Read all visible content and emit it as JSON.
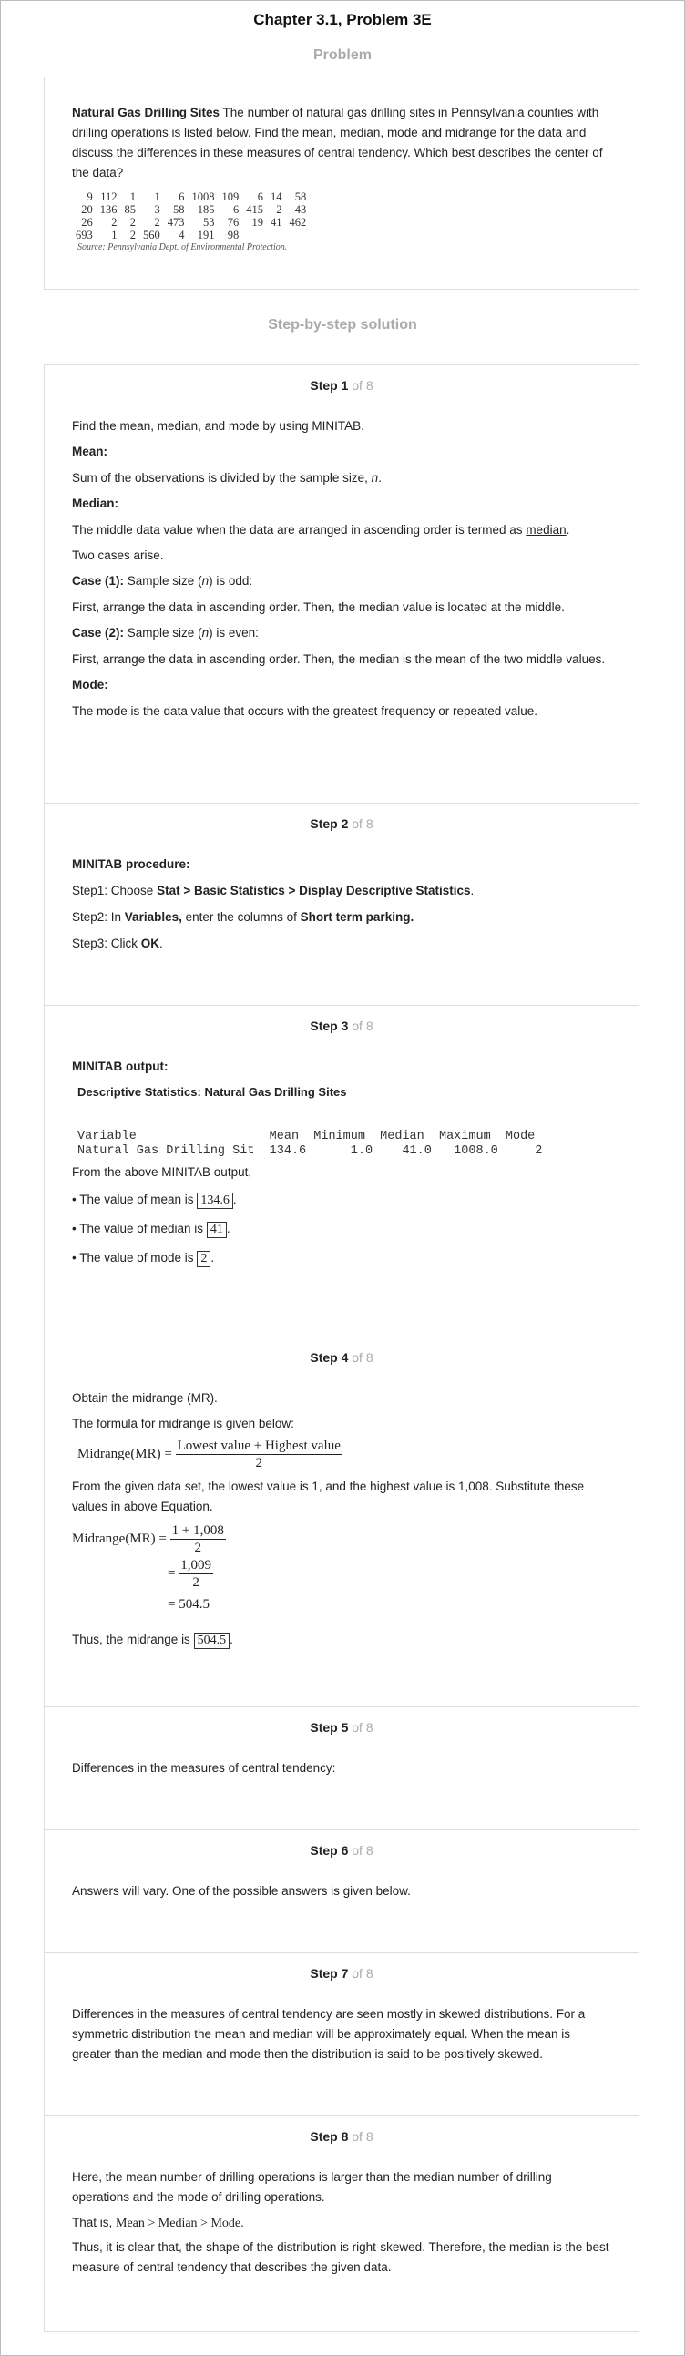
{
  "header": {
    "title": "Chapter 3.1, Problem 3E",
    "problem_heading": "Problem",
    "solution_heading": "Step-by-step solution"
  },
  "problem": {
    "bold": "Natural Gas Drilling Sites",
    "text": " The number of natural gas drilling sites in Pennsylvania counties with drilling operations is listed below. Find the mean, median, mode and midrange for the data and discuss the differences in these measures of central tendency. Which best describes the center of the data?",
    "table": [
      [
        "9",
        "112",
        "1",
        "1",
        "6",
        "1008",
        "109",
        "6",
        "14",
        "58"
      ],
      [
        "20",
        "136",
        "85",
        "3",
        "58",
        "185",
        "6",
        "415",
        "2",
        "43"
      ],
      [
        "26",
        "2",
        "2",
        "2",
        "473",
        "53",
        "76",
        "19",
        "41",
        "462"
      ],
      [
        "693",
        "1",
        "2",
        "560",
        "4",
        "191",
        "98",
        "",
        "",
        ""
      ]
    ],
    "source": "Source: Pennsylvania Dept. of Environmental Protection."
  },
  "step_of": " of 8",
  "steps": {
    "s1": {
      "label": "Step 1",
      "intro": "Find the mean, median, and mode by using MINITAB.",
      "mean_h": "Mean:",
      "mean_t1": "Sum of the observations is divided by the sample size, ",
      "mean_n": "n",
      "mean_t2": ".",
      "median_h": "Median:",
      "median_t1": "The middle data value when the data are arranged in ascending order is termed as ",
      "median_u": "median",
      "median_t2": ".",
      "two_cases": "Two cases arise.",
      "case1_h": "Case (1):",
      "case1_t1": " Sample size (",
      "case1_n": "n",
      "case1_t2": ") is odd:",
      "case1_text": "First, arrange the data in ascending order. Then, the median value is located at the middle.",
      "case2_h": "Case (2):",
      "case2_t1": " Sample size (",
      "case2_n": "n",
      "case2_t2": ") is even:",
      "case2_text": "First, arrange the data in ascending order. Then, the median is the mean of the two middle values.",
      "mode_h": "Mode:",
      "mode_text": "The mode is the data value that occurs with the greatest frequency or repeated value."
    },
    "s2": {
      "label": "Step 2",
      "heading": "MINITAB procedure:",
      "l1_a": "Step1: Choose ",
      "l1_b": "Stat > Basic Statistics > Display Descriptive Statistics",
      "l1_c": ".",
      "l2_a": "Step2: In ",
      "l2_b": "Variables,",
      "l2_c": " enter the columns of ",
      "l2_d": "Short term parking.",
      "l3_a": "Step3: Click ",
      "l3_b": "OK",
      "l3_c": "."
    },
    "s3": {
      "label": "Step 3",
      "heading": "MINITAB output:",
      "subheading": "Descriptive Statistics: Natural Gas Drilling Sites",
      "out_header": "Variable                  Mean  Minimum  Median  Maximum  Mode",
      "out_row": "Natural Gas Drilling Sit  134.6      1.0    41.0   1008.0     2",
      "from_text": "From the above MINITAB output,",
      "mean_t": "• The value of mean is ",
      "mean_v": "134.6",
      "median_t": "• The value of median is ",
      "median_v": "41",
      "mode_t": "• The value of mode is ",
      "mode_v": "2",
      "dot": "."
    },
    "s4": {
      "label": "Step 4",
      "intro": "Obtain the midrange (MR).",
      "formula_intro": "The formula for midrange is given below:",
      "lhs": "Midrange(MR) = ",
      "num": "Lowest value + Highest value",
      "den": "2",
      "given": "From the given data set, the lowest value is 1, and the highest value is 1,008. Substitute these values in above Equation.",
      "eq_num1": "1 + 1,008",
      "eq_den1": "2",
      "eq_num2": "1,009",
      "eq_den2": "2",
      "eq_res": "= 504.5",
      "eq_sign": "=",
      "thus": "Thus, the midrange is ",
      "thus_v": "504.5",
      "dot": "."
    },
    "s5": {
      "label": "Step 5",
      "text": "Differences in the measures of central tendency:"
    },
    "s6": {
      "label": "Step 6",
      "text": "Answers will vary. One of the possible answers is given below."
    },
    "s7": {
      "label": "Step 7",
      "text": "Differences in the measures of central tendency are seen mostly in skewed distributions. For a symmetric distribution the mean and median will be approximately equal. When the mean is greater than the median and mode then the distribution is said to be positively skewed."
    },
    "s8": {
      "label": "Step 8",
      "text1": "Here, the mean number of drilling operations is larger than the median number of drilling operations and the mode of drilling operations.",
      "that_is": "That is, ",
      "expr": "Mean > Median > Mode",
      "expr_dot": ".",
      "text2": "Thus, it is clear that, the shape of the distribution is right-skewed. Therefore, the median is the best measure of central tendency that describes the given data."
    }
  }
}
